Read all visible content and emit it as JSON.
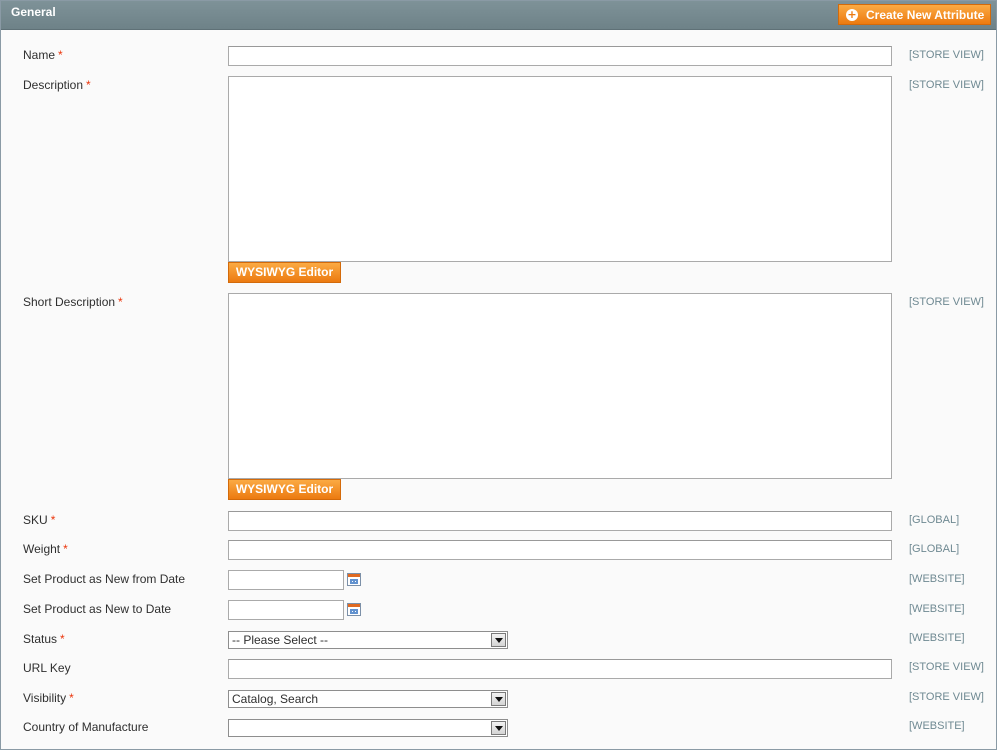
{
  "section": {
    "title": "General",
    "create_button_label": "Create New Attribute"
  },
  "fields": {
    "name": {
      "label": "Name",
      "required": "*",
      "scope": "[STORE VIEW]",
      "value": ""
    },
    "description": {
      "label": "Description",
      "required": "*",
      "scope": "[STORE VIEW]",
      "value": "",
      "editor_button": "WYSIWYG Editor"
    },
    "short_description": {
      "label": "Short Description",
      "required": "*",
      "scope": "[STORE VIEW]",
      "value": "",
      "editor_button": "WYSIWYG Editor"
    },
    "sku": {
      "label": "SKU",
      "required": "*",
      "scope": "[GLOBAL]",
      "value": ""
    },
    "weight": {
      "label": "Weight",
      "required": "*",
      "scope": "[GLOBAL]",
      "value": ""
    },
    "news_from_date": {
      "label": "Set Product as New from Date",
      "scope": "[WEBSITE]",
      "value": "",
      "icon": "calendar-icon"
    },
    "news_to_date": {
      "label": "Set Product as New to Date",
      "scope": "[WEBSITE]",
      "value": "",
      "icon": "calendar-icon"
    },
    "status": {
      "label": "Status",
      "required": "*",
      "scope": "[WEBSITE]",
      "selected": "-- Please Select --"
    },
    "url_key": {
      "label": "URL Key",
      "scope": "[STORE VIEW]",
      "value": ""
    },
    "visibility": {
      "label": "Visibility",
      "required": "*",
      "scope": "[STORE VIEW]",
      "selected": "Catalog, Search"
    },
    "country_of_manufacture": {
      "label": "Country of Manufacture",
      "scope": "[WEBSITE]",
      "selected": ""
    }
  },
  "colors": {
    "header_bg": "#7e9298",
    "accent_orange": "#ec7a10",
    "required_mark": "#eb340a",
    "scope_text": "#6f8992"
  }
}
